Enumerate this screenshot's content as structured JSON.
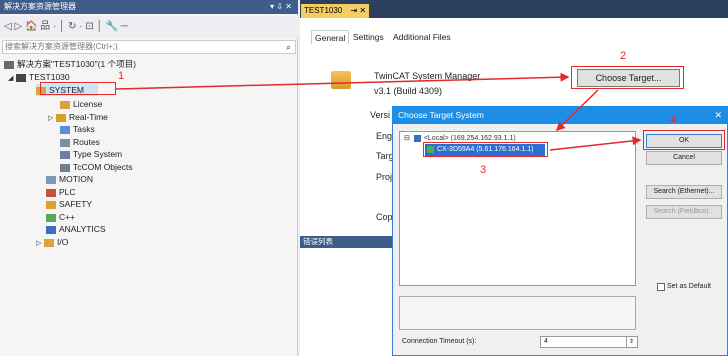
{
  "solution_explorer": {
    "title": "解决方案资源管理器",
    "title_controls": "▾ ⇩ ✕",
    "toolbar": "◁ ▷ 🏠 品 · │ ↻ · ⊡ │ 🔧 ─",
    "search_placeholder": "搜索解决方案资源管理器(Ctrl+;)",
    "solution_label": "解决方案\"TEST1030\"(1 个项目)",
    "tree": [
      {
        "label": "TEST1030",
        "icon": "project-icon",
        "color": "#444"
      },
      {
        "label": "SYSTEM",
        "icon": "system-gear-icon",
        "color": "#d9a43b"
      },
      {
        "label": "License",
        "icon": "license-icon",
        "color": "#d9a43b"
      },
      {
        "label": "Real-Time",
        "icon": "realtime-icon",
        "color": "#d4a020"
      },
      {
        "label": "Tasks",
        "icon": "tasks-icon",
        "color": "#5a8fd6"
      },
      {
        "label": "Routes",
        "icon": "routes-icon",
        "color": "#7a8fa6"
      },
      {
        "label": "Type System",
        "icon": "type-system-icon",
        "color": "#6a7fa0"
      },
      {
        "label": "TcCOM Objects",
        "icon": "tccom-icon",
        "color": "#6f7d8c"
      },
      {
        "label": "MOTION",
        "icon": "motion-icon",
        "color": "#7a9bbd"
      },
      {
        "label": "PLC",
        "icon": "plc-icon",
        "color": "#c8503c"
      },
      {
        "label": "SAFETY",
        "icon": "safety-icon",
        "color": "#e0a030"
      },
      {
        "label": "C++",
        "icon": "cpp-icon",
        "color": "#5aa55a"
      },
      {
        "label": "ANALYTICS",
        "icon": "analytics-icon",
        "color": "#3a6fbf"
      },
      {
        "label": "I/O",
        "icon": "io-icon",
        "color": "#d9a43b"
      }
    ]
  },
  "editor": {
    "tab": "TEST1030",
    "tab_controls": "⇥ ✕",
    "inner_tabs": [
      "General",
      "Settings",
      "Additional Files"
    ],
    "product": "TwinCAT System Manager",
    "version": "v3.1 (Build 4309)",
    "labels": [
      "Versi",
      "Engi",
      "Targ",
      "Proj",
      "Cop"
    ],
    "choose_target_button": "Choose Target..."
  },
  "error_list": {
    "title": "错误列表"
  },
  "dialog": {
    "title": "Choose Target System",
    "close": "✕",
    "local_node": "<Local>  (169.254.162.93.1.1)",
    "target_node": "CX-3D59A4  (5.61.176.164.1.1)",
    "buttons": {
      "ok": "OK",
      "cancel": "Cancel",
      "search_ethernet": "Search (Ethernet)...",
      "search_fieldbus": "Search (Fieldbus)..."
    },
    "set_default": "Set as Default",
    "timeout_label": "Connection Timeout (s):",
    "timeout_value": "4"
  },
  "annotations": {
    "n1": "1",
    "n2": "2",
    "n3": "3",
    "n4": "4",
    "accent": "#e52828"
  }
}
